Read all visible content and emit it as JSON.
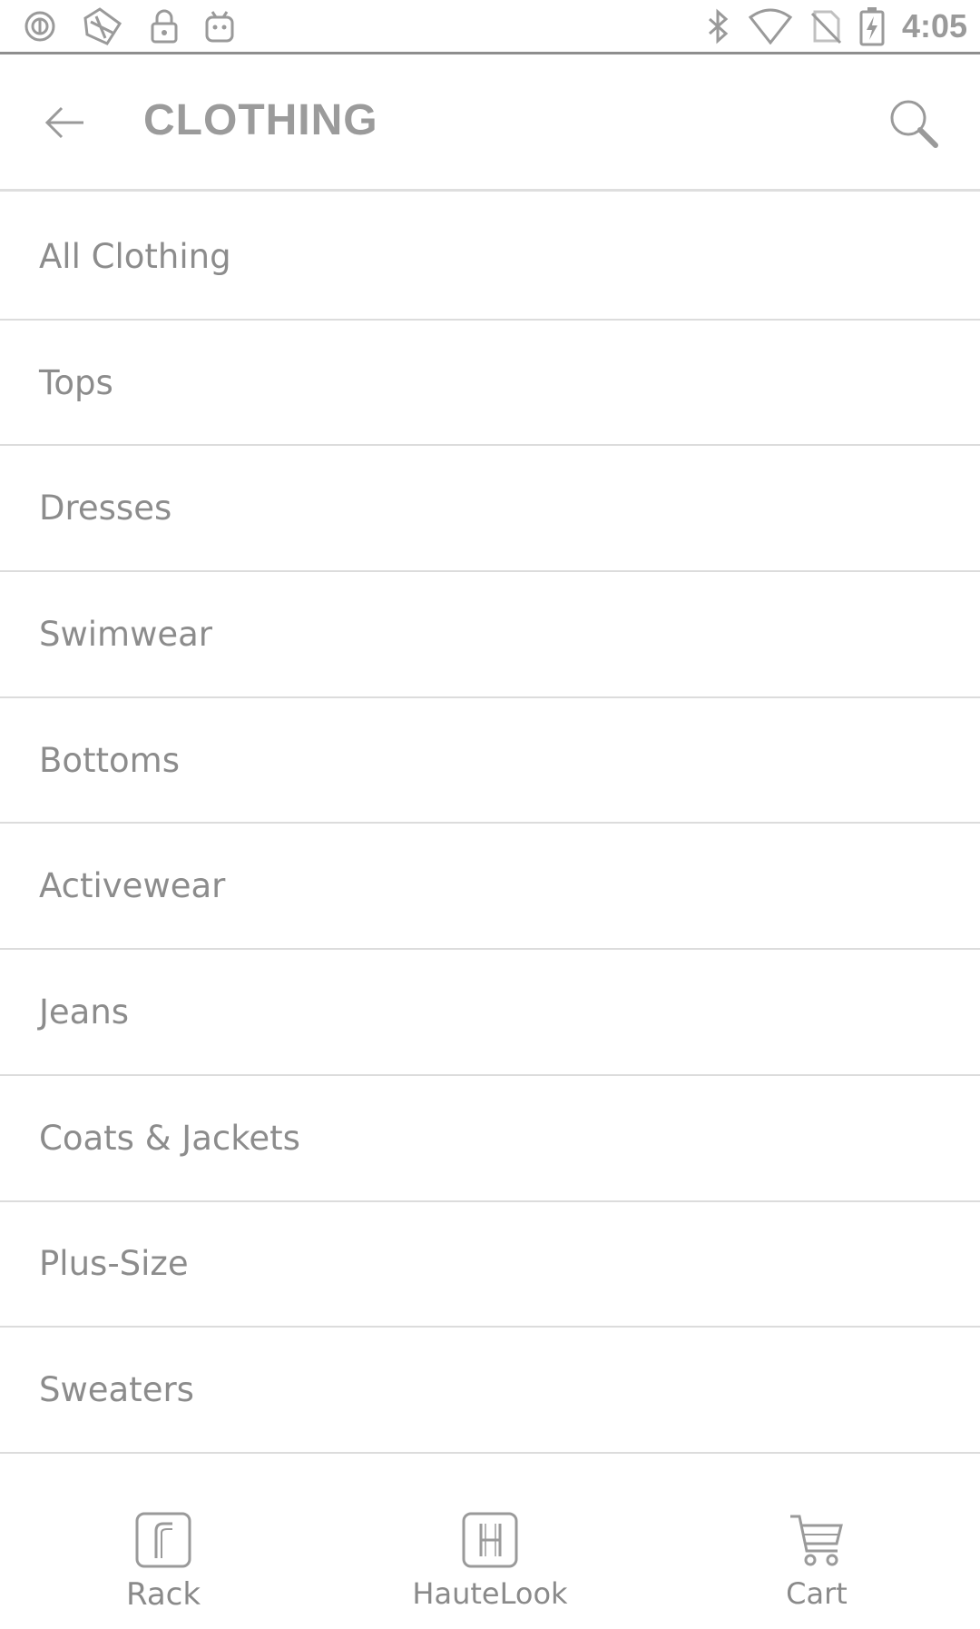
{
  "status_bar": {
    "time": "4:05",
    "left_icons": [
      "app-notification-icon",
      "fave-icon",
      "lock-icon",
      "android-icon"
    ],
    "right_icons": [
      "bluetooth-icon",
      "wifi-icon",
      "no-sim-icon",
      "battery-charging-icon"
    ]
  },
  "header": {
    "title": "CLOTHING",
    "back_icon": "arrow-left-icon",
    "search_icon": "search-icon"
  },
  "categories": [
    {
      "label": "All Clothing"
    },
    {
      "label": "Tops"
    },
    {
      "label": "Dresses"
    },
    {
      "label": "Swimwear"
    },
    {
      "label": "Bottoms"
    },
    {
      "label": "Activewear"
    },
    {
      "label": "Jeans"
    },
    {
      "label": "Coats & Jackets"
    },
    {
      "label": "Plus-Size"
    },
    {
      "label": "Sweaters"
    }
  ],
  "bottom_nav": {
    "items": [
      {
        "label": "Rack",
        "icon": "rack-logo-icon"
      },
      {
        "label": "HauteLook",
        "icon": "hautelook-logo-icon"
      },
      {
        "label": "Cart",
        "icon": "cart-icon"
      }
    ]
  },
  "colors": {
    "text": "#8c8c8c",
    "divider": "#dcdcdc",
    "background": "#ffffff"
  }
}
